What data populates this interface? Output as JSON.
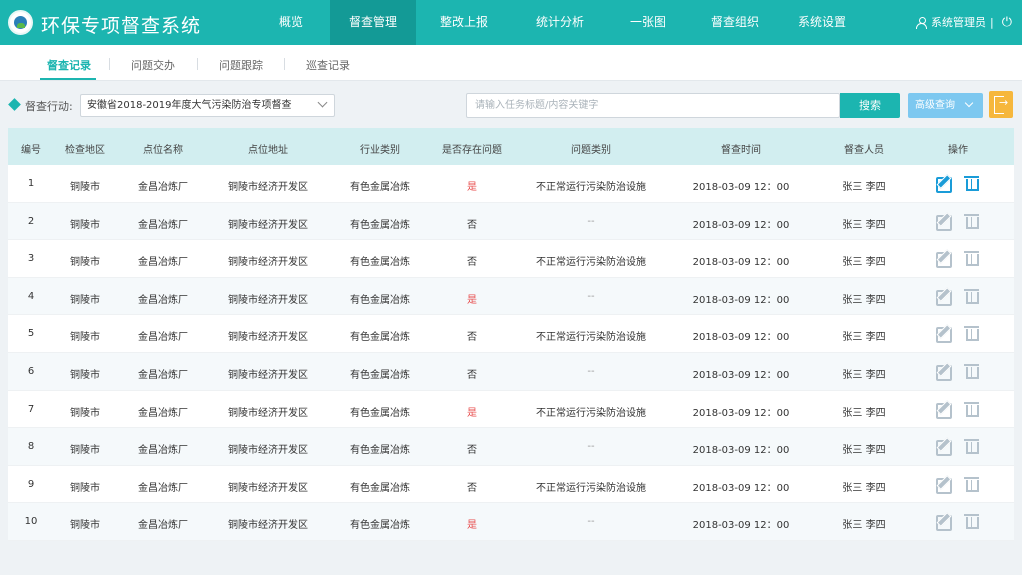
{
  "app": {
    "title": "环保专项督查系统"
  },
  "nav": {
    "items": [
      {
        "label": "概览"
      },
      {
        "label": "督查管理",
        "active": true
      },
      {
        "label": "整改上报"
      },
      {
        "label": "统计分析"
      },
      {
        "label": "一张图"
      },
      {
        "label": "督查组织"
      },
      {
        "label": "系统设置"
      }
    ]
  },
  "user": {
    "name": "系统管理员",
    "divider": "|"
  },
  "subtabs": [
    {
      "label": "督查记录",
      "active": true
    },
    {
      "label": "问题交办"
    },
    {
      "label": "问题跟踪"
    },
    {
      "label": "巡查记录"
    }
  ],
  "filter": {
    "label": "督查行动:",
    "selected": "安徽省2018-2019年度大气污染防治专项督查",
    "search_placeholder": "请输入任务标题/内容关键字",
    "search_button": "搜索",
    "advanced_button": "高级查询"
  },
  "table": {
    "columns": [
      "编号",
      "检查地区",
      "点位名称",
      "点位地址",
      "行业类别",
      "是否存在问题",
      "问题类别",
      "督查时间",
      "督查人员",
      "操作"
    ],
    "rows": [
      {
        "id": "1",
        "region": "铜陵市",
        "site": "金昌冶炼厂",
        "address": "铜陵市经济开发区",
        "industry": "有色金属冶炼",
        "has_issue": "是",
        "issue_type": "不正常运行污染防治设施",
        "time": "2018-03-09 12：00",
        "staff": "张三 李四"
      },
      {
        "id": "2",
        "region": "铜陵市",
        "site": "金昌冶炼厂",
        "address": "铜陵市经济开发区",
        "industry": "有色金属冶炼",
        "has_issue": "否",
        "issue_type": "--",
        "time": "2018-03-09 12：00",
        "staff": "张三 李四"
      },
      {
        "id": "3",
        "region": "铜陵市",
        "site": "金昌冶炼厂",
        "address": "铜陵市经济开发区",
        "industry": "有色金属冶炼",
        "has_issue": "否",
        "issue_type": "不正常运行污染防治设施",
        "time": "2018-03-09 12：00",
        "staff": "张三 李四"
      },
      {
        "id": "4",
        "region": "铜陵市",
        "site": "金昌冶炼厂",
        "address": "铜陵市经济开发区",
        "industry": "有色金属冶炼",
        "has_issue": "是",
        "issue_type": "--",
        "time": "2018-03-09 12：00",
        "staff": "张三 李四"
      },
      {
        "id": "5",
        "region": "铜陵市",
        "site": "金昌冶炼厂",
        "address": "铜陵市经济开发区",
        "industry": "有色金属冶炼",
        "has_issue": "否",
        "issue_type": "不正常运行污染防治设施",
        "time": "2018-03-09 12：00",
        "staff": "张三 李四"
      },
      {
        "id": "6",
        "region": "铜陵市",
        "site": "金昌冶炼厂",
        "address": "铜陵市经济开发区",
        "industry": "有色金属冶炼",
        "has_issue": "否",
        "issue_type": "--",
        "time": "2018-03-09 12：00",
        "staff": "张三 李四"
      },
      {
        "id": "7",
        "region": "铜陵市",
        "site": "金昌冶炼厂",
        "address": "铜陵市经济开发区",
        "industry": "有色金属冶炼",
        "has_issue": "是",
        "issue_type": "不正常运行污染防治设施",
        "time": "2018-03-09 12：00",
        "staff": "张三 李四"
      },
      {
        "id": "8",
        "region": "铜陵市",
        "site": "金昌冶炼厂",
        "address": "铜陵市经济开发区",
        "industry": "有色金属冶炼",
        "has_issue": "否",
        "issue_type": "--",
        "time": "2018-03-09 12：00",
        "staff": "张三 李四"
      },
      {
        "id": "9",
        "region": "铜陵市",
        "site": "金昌冶炼厂",
        "address": "铜陵市经济开发区",
        "industry": "有色金属冶炼",
        "has_issue": "否",
        "issue_type": "不正常运行污染防治设施",
        "time": "2018-03-09 12：00",
        "staff": "张三 李四"
      },
      {
        "id": "10",
        "region": "铜陵市",
        "site": "金昌冶炼厂",
        "address": "铜陵市经济开发区",
        "industry": "有色金属冶炼",
        "has_issue": "是",
        "issue_type": "--",
        "time": "2018-03-09 12：00",
        "staff": "张三 李四"
      }
    ],
    "actions": [
      {
        "icon": "edit-icon",
        "label": "编辑"
      },
      {
        "icon": "trash-icon",
        "label": "删除"
      }
    ]
  },
  "colors": {
    "brand": "#1cb5b0",
    "nav_active": "#139a96",
    "header_row": "#d2eef0",
    "issue_yes": "#e84d4d",
    "action_active": "#1a9cd8",
    "advanced_button": "#7dc8f0",
    "export_button": "#f6b73c"
  }
}
